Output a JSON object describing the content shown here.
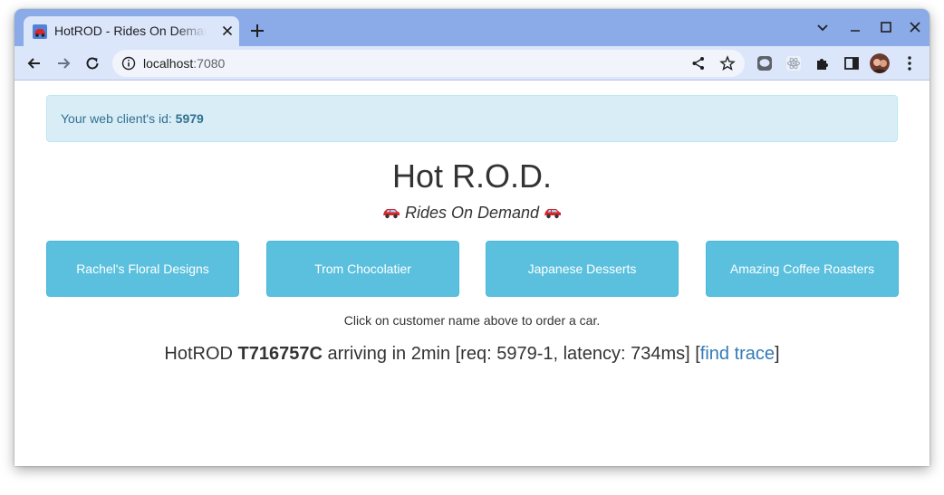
{
  "browser": {
    "tab": {
      "title": "HotROD - Rides On Demand"
    },
    "address": {
      "host": "localhost",
      "port": ":7080"
    }
  },
  "page": {
    "alert": {
      "prefix": "Your web client's id: ",
      "client_id": "5979"
    },
    "title": "Hot R.O.D.",
    "subtitle": "Rides On Demand",
    "customers": [
      {
        "name": "Rachel's Floral Designs"
      },
      {
        "name": "Trom Chocolatier"
      },
      {
        "name": "Japanese Desserts"
      },
      {
        "name": "Amazing Coffee Roasters"
      }
    ],
    "hint": "Click on customer name above to order a car.",
    "ride": {
      "prefix": "HotROD ",
      "driver": "T716757C",
      "arrival": " arriving in 2min [req: 5979-1, latency: 734ms] [",
      "link": "find trace",
      "suffix": "]"
    }
  },
  "colors": {
    "tabstrip": "#8aaae8",
    "toolbar": "#dbe6fb",
    "alert_bg": "#d9edf7",
    "alert_text": "#31708f",
    "button": "#5bc0de",
    "link": "#337ab7"
  },
  "icons": {
    "favicon": "red-car-icon",
    "subtitle": "red-car-icon"
  }
}
